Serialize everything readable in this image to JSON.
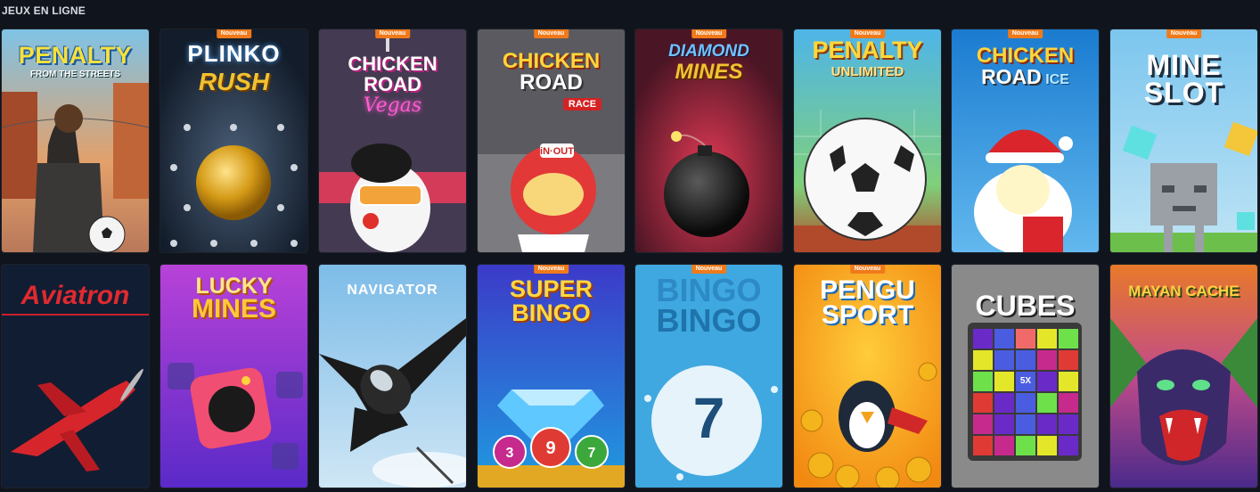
{
  "section": {
    "title": "JEUX EN LIGNE"
  },
  "badge_label": "Nouveau",
  "games": [
    {
      "id": "penalty-streets",
      "title": "PENALTY",
      "subtitle": "FROM THE STREETS",
      "new": false
    },
    {
      "id": "plinko-rush",
      "title": "PLINKO",
      "subtitle": "RUSH",
      "new": true
    },
    {
      "id": "chicken-road-vegas",
      "title": "CHICKEN",
      "subtitle": "ROAD",
      "extra": "Vegas",
      "new": true
    },
    {
      "id": "chicken-road-race",
      "title": "CHICKEN",
      "subtitle": "ROAD",
      "extra": "RACE",
      "new": true
    },
    {
      "id": "diamond-mines",
      "title": "DIAMOND",
      "subtitle": "MINES",
      "new": true
    },
    {
      "id": "penalty-unlimited",
      "title": "PENALTY",
      "subtitle": "UNLIMITED",
      "new": true
    },
    {
      "id": "chicken-road-ice",
      "title": "CHICKEN",
      "subtitle": "ROAD",
      "extra": "ICE",
      "new": true
    },
    {
      "id": "mine-slot",
      "title": "MINE",
      "subtitle": "SLOT",
      "new": true
    },
    {
      "id": "aviatron",
      "title": "Aviatron",
      "new": false
    },
    {
      "id": "lucky-mines",
      "title": "LUCKY",
      "subtitle": "MINES",
      "new": false
    },
    {
      "id": "navigator",
      "title": "NAVIGATOR",
      "new": false
    },
    {
      "id": "super-bingo",
      "title": "SUPER",
      "subtitle": "BINGO",
      "new": true
    },
    {
      "id": "bingo-bingo",
      "title": "BINGO",
      "subtitle": "BINGO",
      "ball": "7",
      "new": true
    },
    {
      "id": "pengu-sport",
      "title": "PENGU",
      "subtitle": "SPORT",
      "new": true
    },
    {
      "id": "cubes",
      "title": "CUBES",
      "multiplier": "5X",
      "new": false
    },
    {
      "id": "mayan-cache",
      "title": "MAYAN CACHE",
      "new": false
    }
  ],
  "colors": {
    "background": "#10151d",
    "badge": "#f07a1a"
  }
}
